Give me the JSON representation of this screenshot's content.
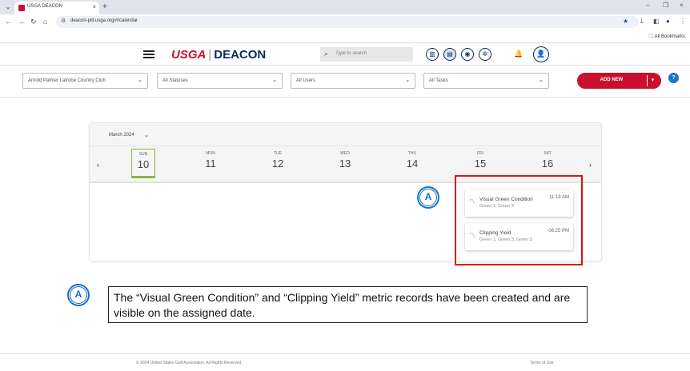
{
  "browser": {
    "tab_title": "USGA DEACON",
    "url": "deacon-pilt.usga.org/#/calendar",
    "bookmarks_label": "All Bookmarks"
  },
  "header": {
    "logo_usga": "USGA",
    "logo_deacon": "DEACON",
    "search_placeholder": "Type to search"
  },
  "filters": {
    "club": "Arnold Palmer Latrobe Country Club",
    "statuses": "All Statuses",
    "users": "All Users",
    "tasks": "All Tasks",
    "add_new": "ADD NEW",
    "help": "?"
  },
  "calendar": {
    "month": "March 2024",
    "days": [
      {
        "name": "SUN",
        "date": "10"
      },
      {
        "name": "MON",
        "date": "11"
      },
      {
        "name": "TUE",
        "date": "12"
      },
      {
        "name": "WED",
        "date": "13"
      },
      {
        "name": "THU",
        "date": "14"
      },
      {
        "name": "FRI",
        "date": "15"
      },
      {
        "name": "SAT",
        "date": "16"
      }
    ],
    "events": [
      {
        "name": "Visual Green Condition",
        "sub": "Green 1, Green 3",
        "time": "11:18 AM"
      },
      {
        "name": "Clipping Yield",
        "sub": "Green 1, Green 3, Green 5",
        "time": "06:25 PM"
      }
    ]
  },
  "annotation": {
    "marker": "A",
    "note": "The “Visual Green Condition” and “Clipping Yield” metric records have been created and are visible on the assigned date."
  },
  "footer": {
    "copyright": "© 2024 United States Golf Association. All Rights Reserved.",
    "terms": "Terms of Use"
  }
}
